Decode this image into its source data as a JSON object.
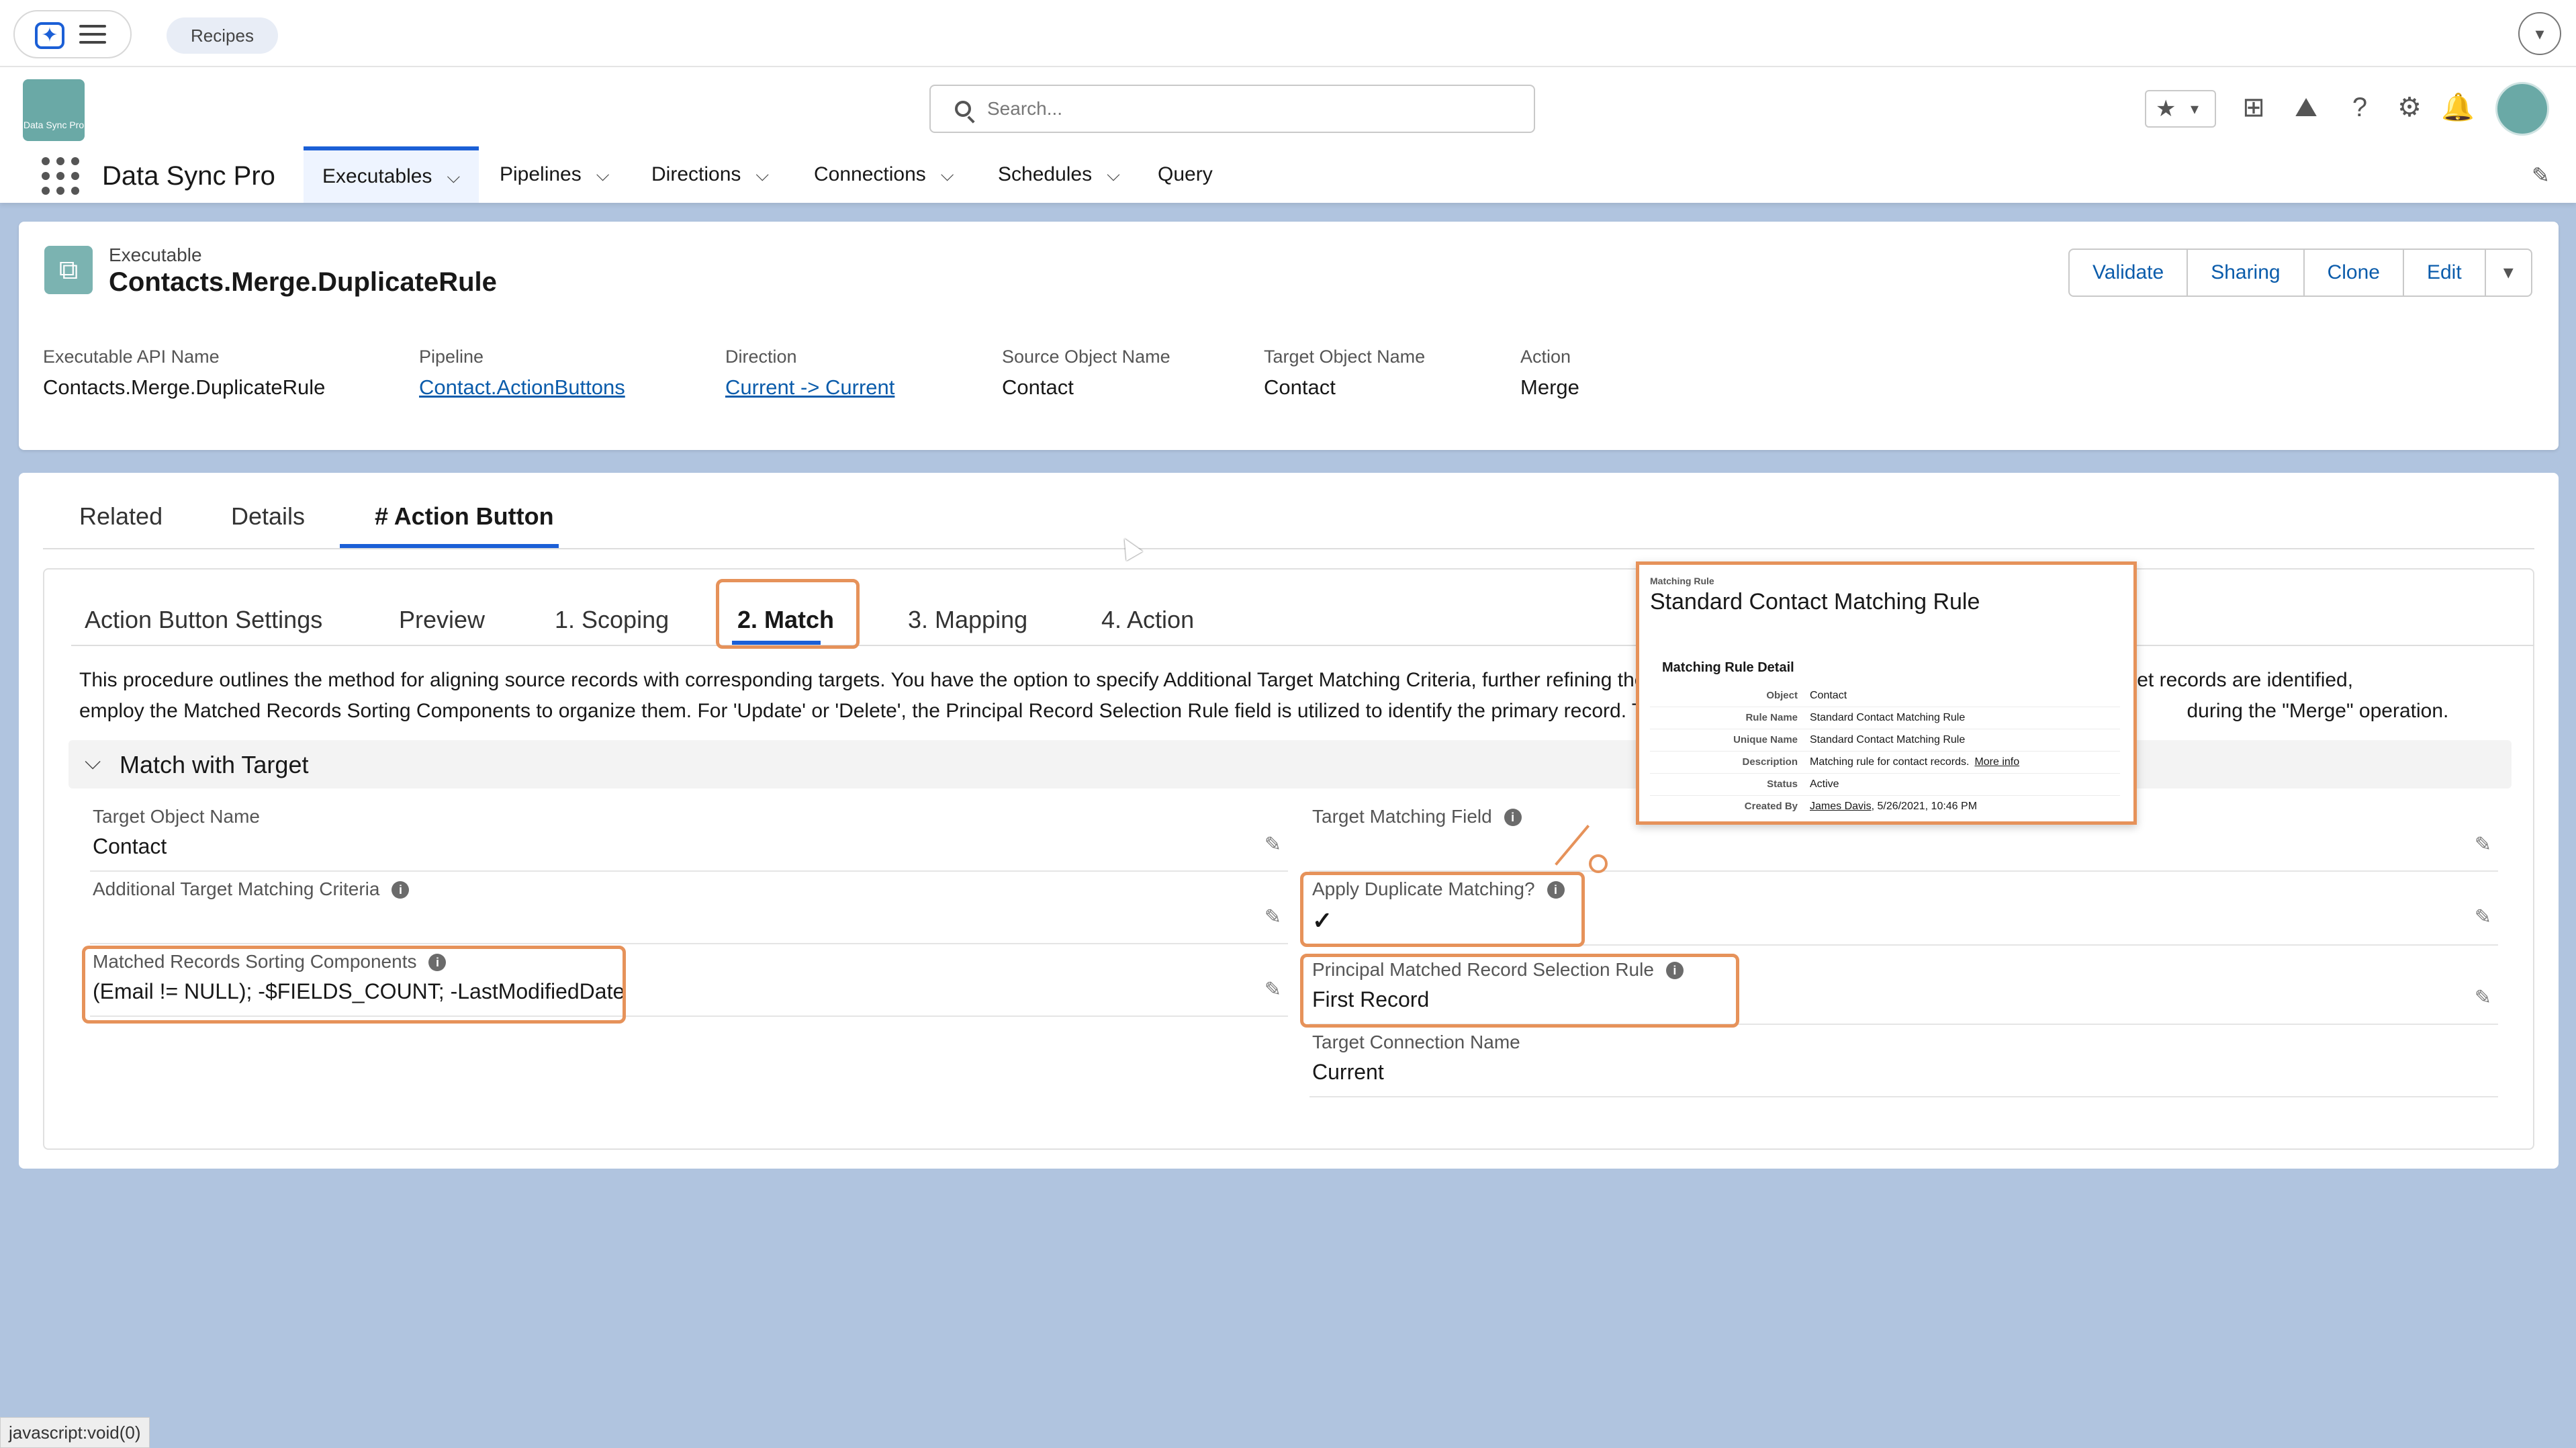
{
  "topbar": {
    "recipes_label": "Recipes"
  },
  "header": {
    "logo_text": "Data Sync Pro",
    "search_placeholder": "Search...",
    "app_name": "Data Sync Pro",
    "nav": [
      {
        "label": "Executables",
        "active": true
      },
      {
        "label": "Pipelines"
      },
      {
        "label": "Directions"
      },
      {
        "label": "Connections"
      },
      {
        "label": "Schedules"
      },
      {
        "label": "Query"
      }
    ]
  },
  "record": {
    "kind": "Executable",
    "title": "Contacts.Merge.DuplicateRule",
    "actions": [
      "Validate",
      "Sharing",
      "Clone",
      "Edit"
    ],
    "highlights": [
      {
        "label": "Executable API Name",
        "value": "Contacts.Merge.DuplicateRule"
      },
      {
        "label": "Pipeline",
        "value": "Contact.ActionButtons"
      },
      {
        "label": "Direction",
        "value": "Current -> Current"
      },
      {
        "label": "Source Object Name",
        "value": "Contact"
      },
      {
        "label": "Target Object Name",
        "value": "Contact"
      },
      {
        "label": "Action",
        "value": "Merge"
      }
    ]
  },
  "tabs": [
    "Related",
    "Details",
    "# Action Button"
  ],
  "subtabs": [
    "Action Button Settings",
    "Preview",
    "1. Scoping",
    "2. Match",
    "3. Mapping",
    "4. Action"
  ],
  "description": {
    "line1_left": "This procedure outlines the method for aligning source records with corresponding targets. You have the option to specify Additional Target Matching Criteria, further refining the s",
    "line1_right": "n multiple target records are identified,",
    "line2_left": "employ the Matched Records Sorting Components to organize them. For 'Update' or 'Delete', the Principal Record Selection Rule field is utilized to identify the primary record. This",
    "line2_right": "during the \"Merge\" operation."
  },
  "section": {
    "title": "Match with Target",
    "left_fields": [
      {
        "label": "Target Object Name",
        "value": "Contact"
      },
      {
        "label": "Additional Target Matching Criteria",
        "value": ""
      },
      {
        "label": "Matched Records Sorting Components",
        "value": "(Email != NULL); -$FIELDS_COUNT; -LastModifiedDate"
      }
    ],
    "right_fields": [
      {
        "label": "Target Matching Field",
        "value": ""
      },
      {
        "label": "Apply Duplicate Matching?",
        "value": "checked"
      },
      {
        "label": "Principal Matched Record Selection Rule",
        "value": "First Record"
      },
      {
        "label": "Target Connection Name",
        "value": "Current"
      }
    ]
  },
  "popover": {
    "kind": "Matching Rule",
    "title": "Standard Contact Matching Rule",
    "section": "Matching Rule Detail",
    "rows": [
      {
        "key": "Object",
        "value": "Contact"
      },
      {
        "key": "Rule Name",
        "value": "Standard Contact Matching Rule"
      },
      {
        "key": "Unique Name",
        "value": "Standard Contact Matching Rule"
      },
      {
        "key": "Description",
        "value": "Matching rule for contact records.",
        "link": "More info"
      },
      {
        "key": "Status",
        "value": "Active"
      },
      {
        "key": "Created By",
        "value": "James Davis",
        "suffix": ", 5/26/2021, 10:46 PM"
      }
    ]
  },
  "statusbar": "javascript:void(0)",
  "colors": {
    "accent": "#1b5fd6",
    "link": "#0b5cab",
    "highlight_box": "#e6925a",
    "background": "#b0c4df"
  }
}
